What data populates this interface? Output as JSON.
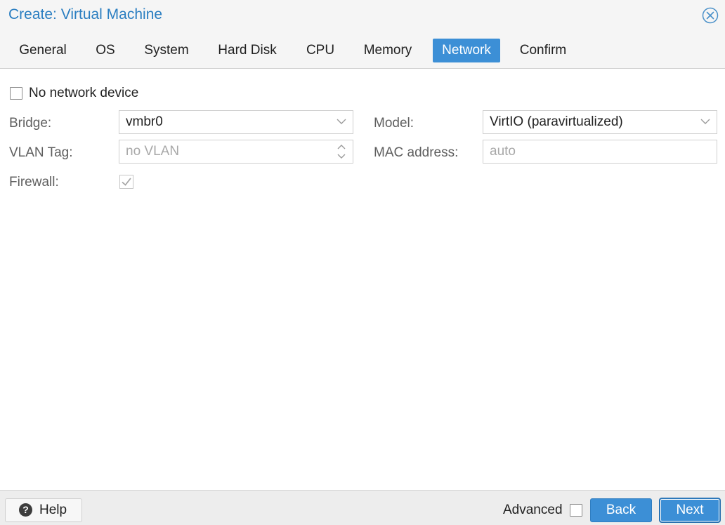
{
  "window": {
    "title": "Create: Virtual Machine",
    "close_icon": "close-circle-icon"
  },
  "tabs": [
    {
      "label": "General",
      "active": false
    },
    {
      "label": "OS",
      "active": false
    },
    {
      "label": "System",
      "active": false
    },
    {
      "label": "Hard Disk",
      "active": false
    },
    {
      "label": "CPU",
      "active": false
    },
    {
      "label": "Memory",
      "active": false
    },
    {
      "label": "Network",
      "active": true
    },
    {
      "label": "Confirm",
      "active": false
    }
  ],
  "form": {
    "no_network": {
      "label": "No network device",
      "checked": false
    },
    "bridge": {
      "label": "Bridge:",
      "value": "vmbr0"
    },
    "vlan": {
      "label": "VLAN Tag:",
      "placeholder": "no VLAN"
    },
    "firewall": {
      "label": "Firewall:",
      "checked": true
    },
    "model": {
      "label": "Model:",
      "value": "VirtIO (paravirtualized)"
    },
    "mac": {
      "label": "MAC address:",
      "placeholder": "auto"
    }
  },
  "footer": {
    "help_label": "Help",
    "advanced_label": "Advanced",
    "advanced_checked": false,
    "back_label": "Back",
    "next_label": "Next"
  },
  "colors": {
    "accent": "#3c8fd6",
    "title": "#2a7ec1"
  }
}
